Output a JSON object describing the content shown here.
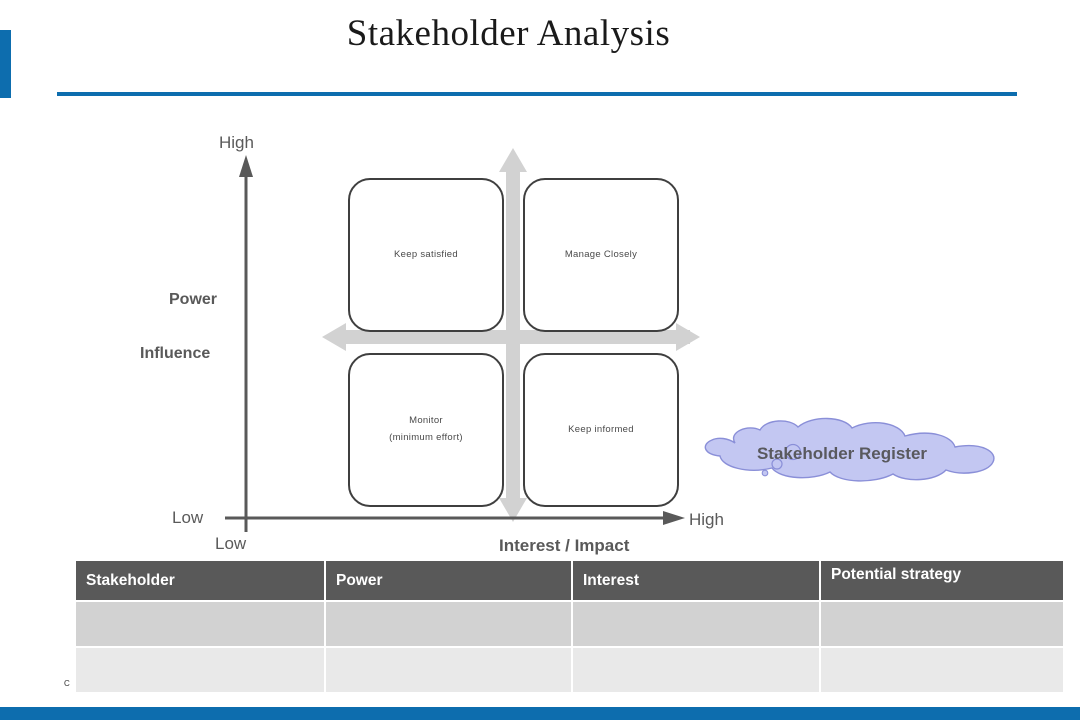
{
  "slide": {
    "title": "Stakeholder Analysis",
    "accent_color": "#0D6DAE",
    "stray_text": "C"
  },
  "matrix": {
    "y_axis": {
      "high_label": "High",
      "low_label": "Low",
      "name_line1": "Power",
      "name_line2": "Influence"
    },
    "x_axis": {
      "low_label": "Low",
      "high_label": "High",
      "name": "Interest  / Impact"
    },
    "quadrants": [
      {
        "id": "keep-satisfied",
        "label": "Keep satisfied",
        "position": "top-left"
      },
      {
        "id": "manage-closely",
        "label": "Manage Closely",
        "position": "top-right"
      },
      {
        "id": "monitor",
        "label": "Monitor\n(minimum effort)",
        "line1": "Monitor",
        "line2": "(minimum effort)",
        "position": "bottom-left"
      },
      {
        "id": "keep-informed",
        "label": "Keep informed",
        "position": "bottom-right"
      }
    ],
    "arrow_color": "#D2D2D2",
    "axis_color": "#595959",
    "box_border_color": "#3F3F3F"
  },
  "callout": {
    "label": "Stakeholder Register",
    "fill_color": "#C3C7F2",
    "stroke_color": "#8A8FD8",
    "text_color": "#59595E"
  },
  "table": {
    "headers": [
      "Stakeholder",
      "Power",
      "Interest",
      "Potential strategy"
    ],
    "rows": [
      [
        "",
        "",
        "",
        ""
      ],
      [
        "",
        "",
        "",
        ""
      ]
    ],
    "header_bg": "#595959",
    "row_colors": [
      "#D2D2D2",
      "#E9E9E9"
    ]
  }
}
